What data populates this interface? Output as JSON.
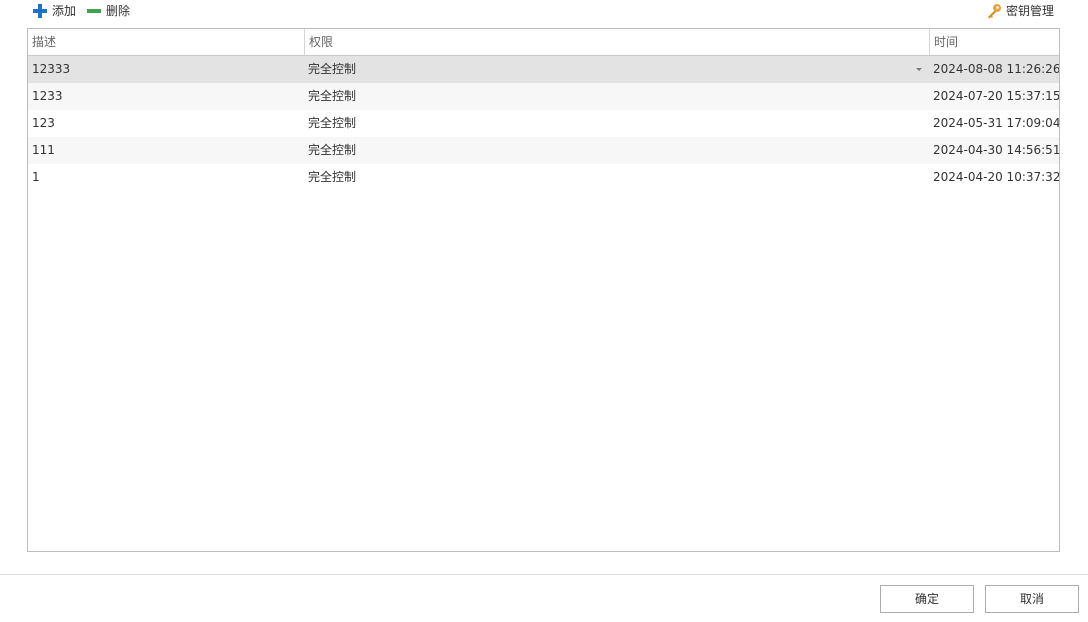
{
  "toolbar": {
    "add_label": "添加",
    "delete_label": "删除",
    "key_manage_label": "密钥管理"
  },
  "colors": {
    "add_icon": "#1a73c8",
    "delete_icon": "#3fa34d",
    "key_icon": "#e8a43a",
    "selected_row": "#e3e3e3",
    "alt_row": "#f7f7f7",
    "border": "#bdbdbd"
  },
  "table": {
    "headers": {
      "description": "描述",
      "permission": "权限",
      "time": "时间"
    },
    "rows": [
      {
        "description": "12333",
        "permission": "完全控制",
        "time": "2024-08-08 11:26:26"
      },
      {
        "description": "1233",
        "permission": "完全控制",
        "time": "2024-07-20 15:37:15"
      },
      {
        "description": "123",
        "permission": "完全控制",
        "time": "2024-05-31 17:09:04"
      },
      {
        "description": "111",
        "permission": "完全控制",
        "time": "2024-04-30 14:56:51"
      },
      {
        "description": "1",
        "permission": "完全控制",
        "time": "2024-04-20 10:37:32"
      }
    ]
  },
  "footer": {
    "ok_label": "确定",
    "cancel_label": "取消"
  }
}
